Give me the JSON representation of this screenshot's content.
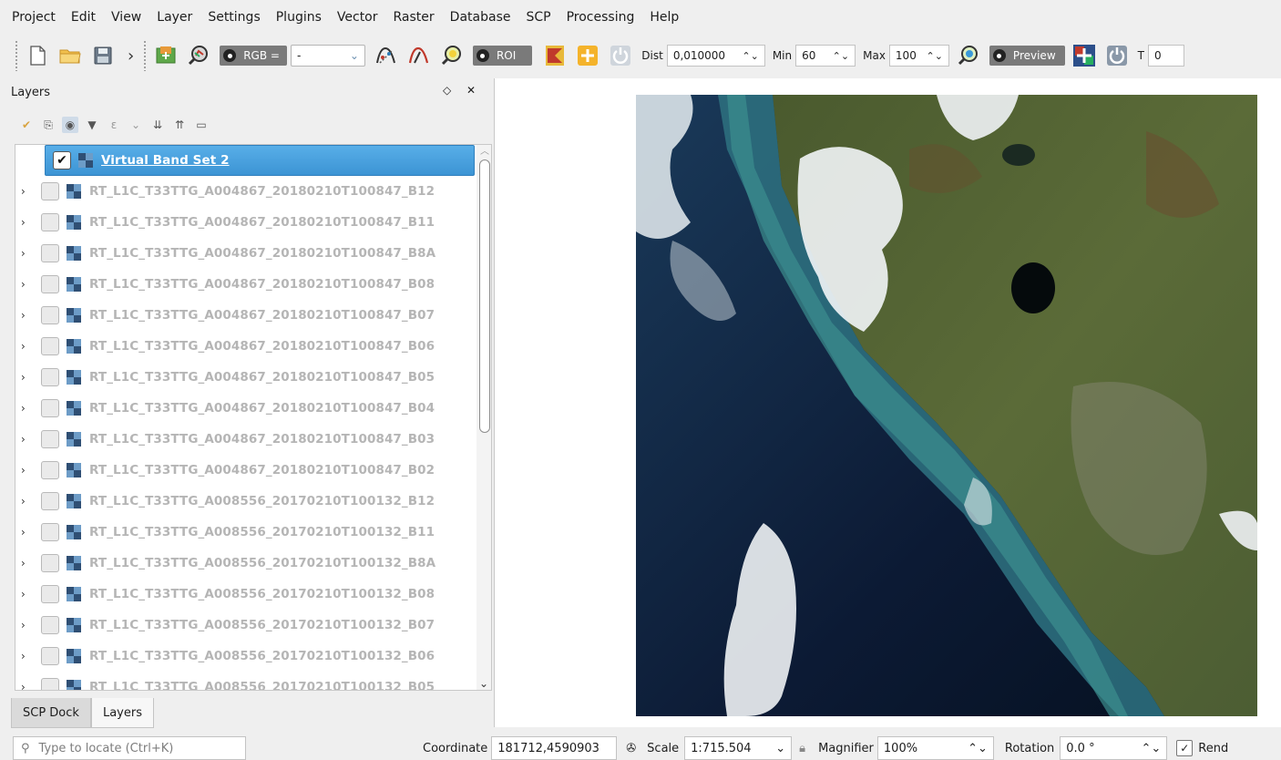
{
  "menu": [
    "Project",
    "Edit",
    "View",
    "Layer",
    "Settings",
    "Plugins",
    "Vector",
    "Raster",
    "Database",
    "SCP",
    "Processing",
    "Help"
  ],
  "toolbar": {
    "rgb_label": "RGB =",
    "rgb_value": "-",
    "roi_label": "ROI",
    "dist_label": "Dist",
    "dist_value": "0,010000",
    "min_label": "Min",
    "min_value": "60",
    "max_label": "Max",
    "max_value": "100",
    "preview_label": "Preview",
    "t_label": "T",
    "t_value": "0"
  },
  "layers_panel": {
    "title": "Layers",
    "items": [
      {
        "name": "Virtual Band Set 2",
        "checked": true,
        "selected": true
      },
      {
        "name": "RT_L1C_T33TTG_A004867_20180210T100847_B12"
      },
      {
        "name": "RT_L1C_T33TTG_A004867_20180210T100847_B11"
      },
      {
        "name": "RT_L1C_T33TTG_A004867_20180210T100847_B8A"
      },
      {
        "name": "RT_L1C_T33TTG_A004867_20180210T100847_B08"
      },
      {
        "name": "RT_L1C_T33TTG_A004867_20180210T100847_B07"
      },
      {
        "name": "RT_L1C_T33TTG_A004867_20180210T100847_B06"
      },
      {
        "name": "RT_L1C_T33TTG_A004867_20180210T100847_B05"
      },
      {
        "name": "RT_L1C_T33TTG_A004867_20180210T100847_B04"
      },
      {
        "name": "RT_L1C_T33TTG_A004867_20180210T100847_B03"
      },
      {
        "name": "RT_L1C_T33TTG_A004867_20180210T100847_B02"
      },
      {
        "name": "RT_L1C_T33TTG_A008556_20170210T100132_B12"
      },
      {
        "name": "RT_L1C_T33TTG_A008556_20170210T100132_B11"
      },
      {
        "name": "RT_L1C_T33TTG_A008556_20170210T100132_B8A"
      },
      {
        "name": "RT_L1C_T33TTG_A008556_20170210T100132_B08"
      },
      {
        "name": "RT_L1C_T33TTG_A008556_20170210T100132_B07"
      },
      {
        "name": "RT_L1C_T33TTG_A008556_20170210T100132_B06"
      },
      {
        "name": "RT_L1C_T33TTG_A008556_20170210T100132_B05"
      }
    ]
  },
  "tabs": [
    "SCP Dock",
    "Layers"
  ],
  "status": {
    "locate_placeholder": "Type to locate (Ctrl+K)",
    "coordinate_label": "Coordinate",
    "coordinate_value": "181712,4590903",
    "scale_label": "Scale",
    "scale_value": "1:715.504",
    "magnifier_label": "Magnifier",
    "magnifier_value": "100%",
    "rotation_label": "Rotation",
    "rotation_value": "0.0 °",
    "render_label": "Rend"
  }
}
